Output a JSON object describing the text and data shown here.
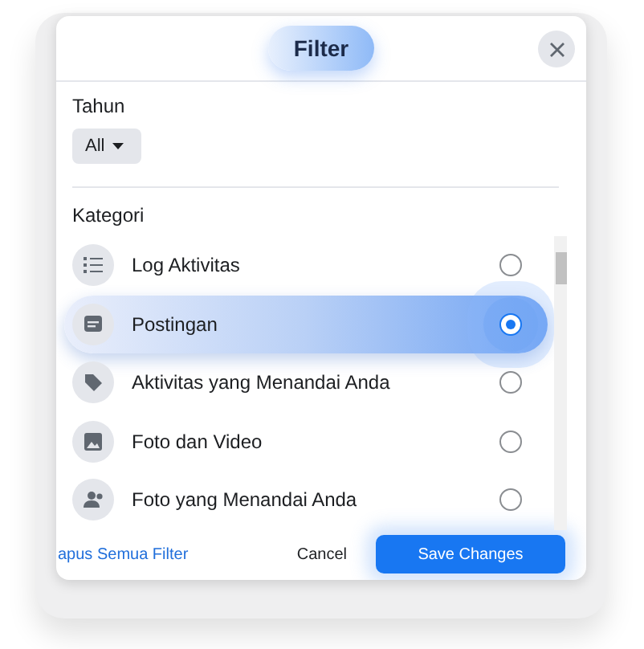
{
  "dialog": {
    "title": "Filter"
  },
  "year": {
    "label": "Tahun",
    "value": "All"
  },
  "category": {
    "label": "Kategori",
    "items": [
      {
        "label": "Log Aktivitas",
        "kind": "list",
        "selected": false
      },
      {
        "label": "Postingan",
        "kind": "post",
        "selected": true
      },
      {
        "label": "Aktivitas yang Menandai Anda",
        "kind": "tag",
        "selected": false
      },
      {
        "label": "Foto dan Video",
        "kind": "photo",
        "selected": false
      },
      {
        "label": "Foto yang Menandai Anda",
        "kind": "people",
        "selected": false
      }
    ]
  },
  "footer": {
    "clear_link": "apus Semua Filter",
    "cancel": "Cancel",
    "save": "Save Changes"
  }
}
